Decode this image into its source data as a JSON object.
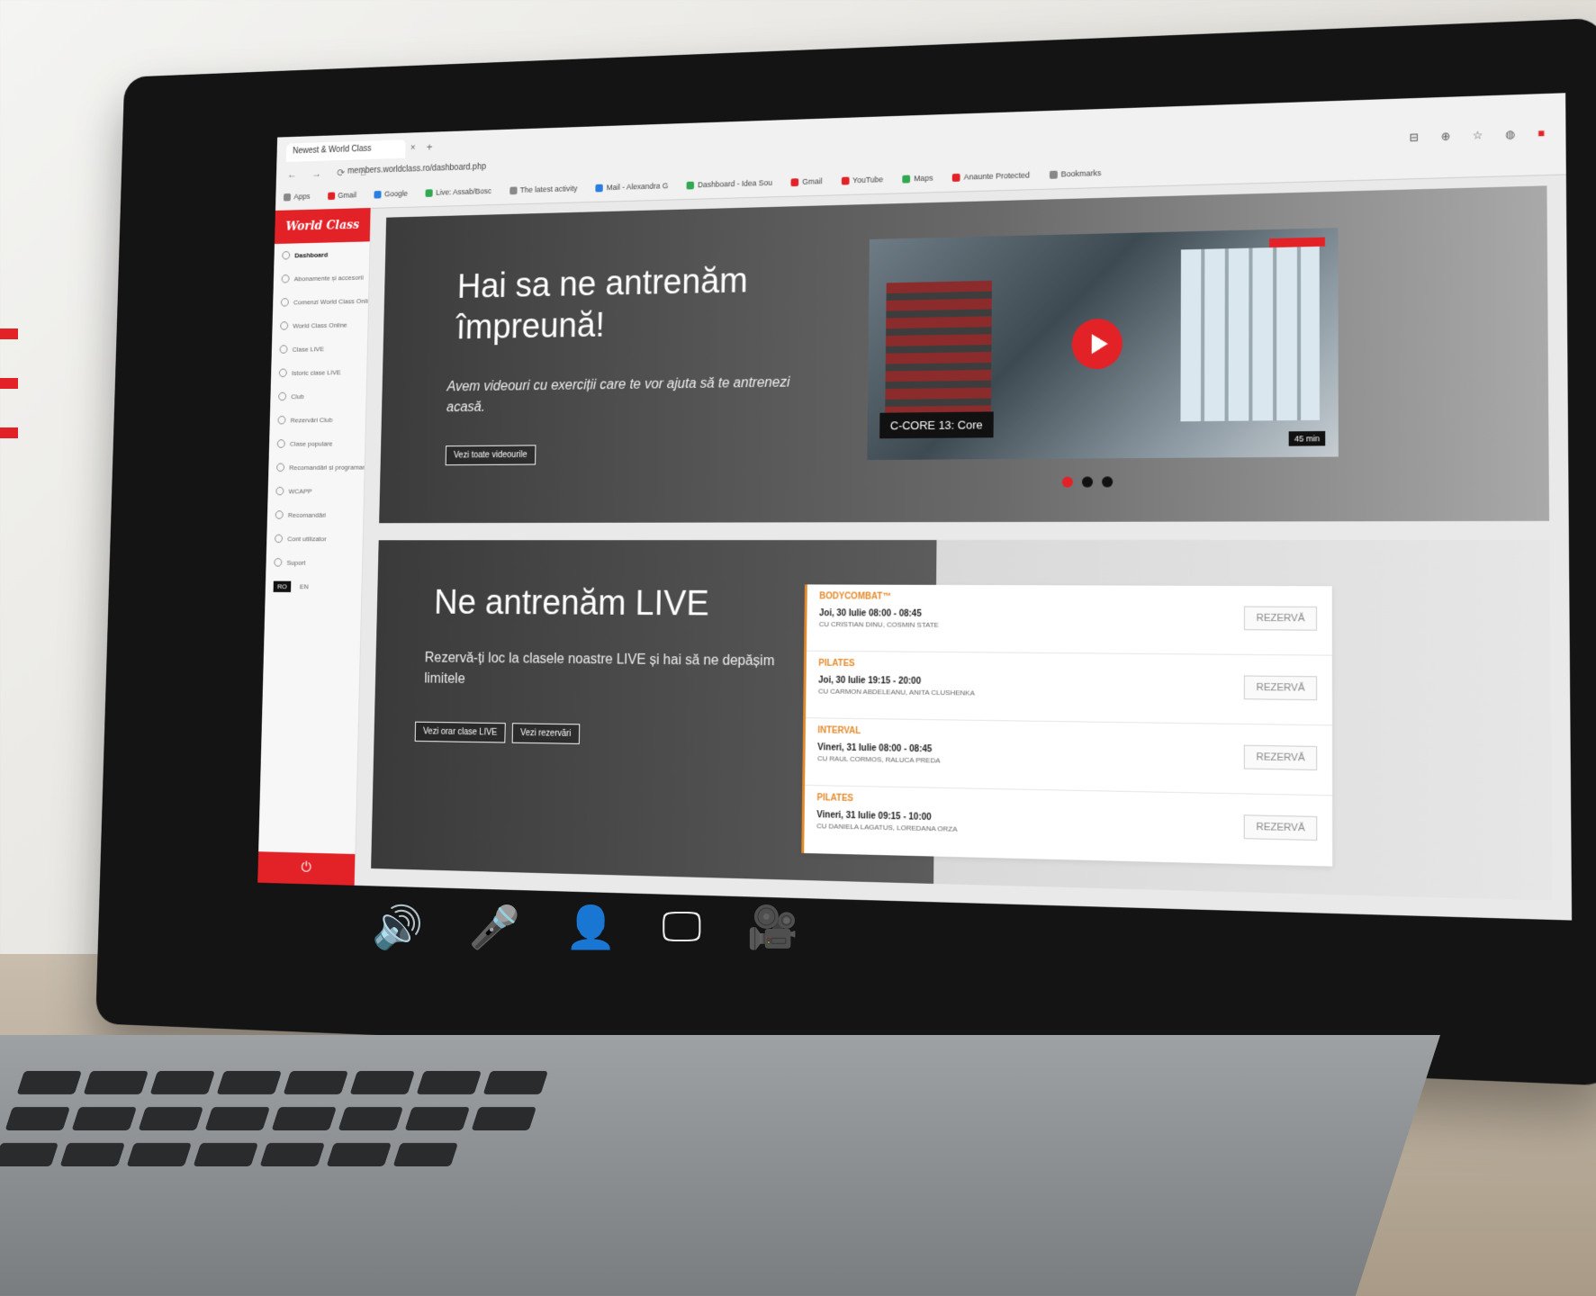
{
  "browser": {
    "tab_title": "Newest & World Class",
    "tab_close": "×",
    "tab_add": "+",
    "nav_icons": "← → ⟳ ⌂",
    "address": "members.worldclass.ro/dashboard.php",
    "extension_icons": "⊟ ⊕ ☆ ◍",
    "extension_red": "■",
    "bookmarks": [
      "Apps",
      "Gmail",
      "Google",
      "Live: Assab/Bosc",
      "The latest activity",
      "Mail - Alexandra G",
      "Dashboard - Idea Sou",
      "Gmail",
      "YouTube",
      "Maps",
      "Anaunte Protected",
      "Bookmarks"
    ]
  },
  "sidebar": {
    "logo": "World Class",
    "items": [
      {
        "label": "Dashboard",
        "active": true
      },
      {
        "label": "Abonamente și accesorii"
      },
      {
        "label": "Comenzi World Class Online"
      },
      {
        "label": "World Class Online"
      },
      {
        "label": "Clase LIVE"
      },
      {
        "label": "Istoric clase LIVE"
      },
      {
        "label": "Club"
      },
      {
        "label": "Rezervări Club"
      },
      {
        "label": "Clase populare"
      },
      {
        "label": "Recomandări și programare"
      },
      {
        "label": "WCAPP"
      },
      {
        "label": "Recomandări"
      },
      {
        "label": "Cont utilizator"
      },
      {
        "label": "Suport"
      }
    ],
    "lang_active": "RO",
    "lang_other": "EN",
    "logout_icon": "⏻"
  },
  "hero": {
    "title": "Hai sa ne antrenăm împreună!",
    "subtitle": "Avem videouri cu exerciții care te vor ajuta să te antrenezi acasă.",
    "button": "Vezi toate videourile"
  },
  "video": {
    "label": "C-CORE 13: Core",
    "duration": "45 min"
  },
  "carousel": {
    "count": 3,
    "active": 0
  },
  "live": {
    "title": "Ne antrenăm LIVE",
    "subtitle": "Rezervă-ți loc la clasele noastre LIVE și hai să ne depășim limitele",
    "button_schedule": "Vezi orar clase LIVE",
    "button_reservations": "Vezi rezervări"
  },
  "classes": [
    {
      "name": "BODYCOMBAT™",
      "time": "Joi, 30 Iulie 08:00 - 08:45",
      "trainers": "cu CRISTIAN DINU, COSMIN STATE",
      "action": "REZERVĂ"
    },
    {
      "name": "PILATES",
      "time": "Joi, 30 Iulie 19:15 - 20:00",
      "trainers": "cu CARMON ABDELEANU, ANITA CLUSHENKA",
      "action": "REZERVĂ"
    },
    {
      "name": "INTERVAL",
      "time": "Vineri, 31 Iulie 08:00 - 08:45",
      "trainers": "cu RAUL CORMOS, RALUCA PREDA",
      "action": "REZERVĂ"
    },
    {
      "name": "PILATES",
      "time": "Vineri, 31 Iulie 09:15 - 10:00",
      "trainers": "cu DANIELA LAGATUS, LOREDANA ORZA",
      "action": "REZERVĂ"
    }
  ],
  "toolbar_icons": [
    "sound-icon",
    "microphone-icon",
    "user-icon",
    "screen-icon",
    "camera-icon"
  ],
  "toolbar_glyphs": [
    "🔊",
    "🎤",
    "👤",
    "🖵",
    "🎥"
  ],
  "colors": {
    "accent": "#e32228",
    "class_label": "#e38a2b",
    "dark_panel": "#3a3a3a"
  }
}
